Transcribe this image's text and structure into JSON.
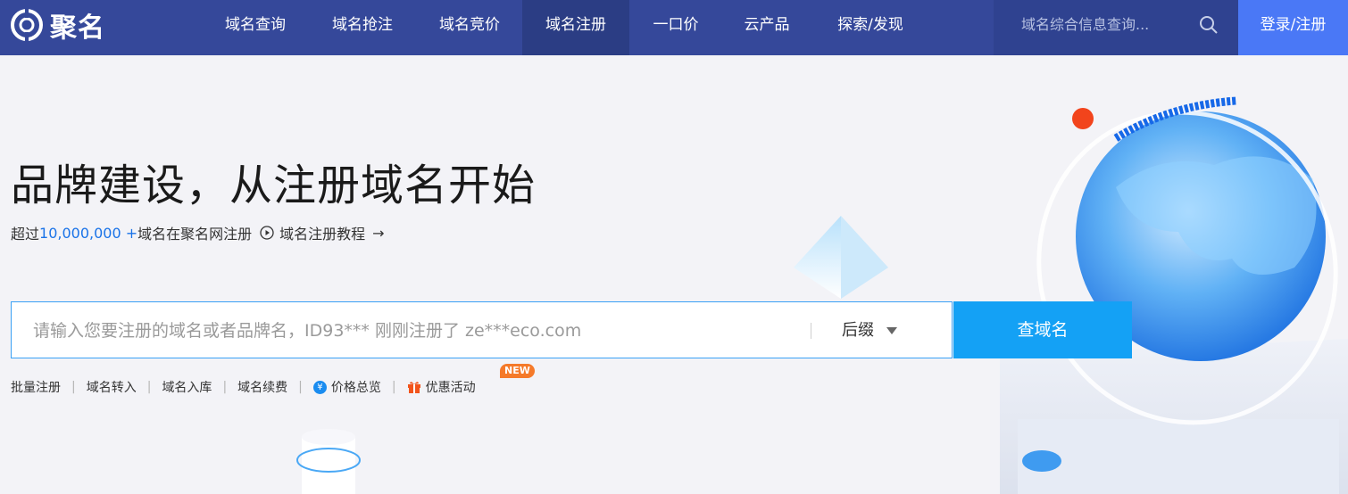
{
  "logo": {
    "text": "聚名"
  },
  "nav": {
    "items": [
      "域名查询",
      "域名抢注",
      "域名竞价",
      "域名注册",
      "一口价",
      "云产品",
      "探索/发现"
    ],
    "active": "域名注册"
  },
  "header_search": {
    "placeholder": "域名综合信息查询..."
  },
  "login": {
    "label": "登录/注册"
  },
  "hero": {
    "title": "品牌建设，从注册域名开始",
    "stats_prefix": "超过",
    "stats_number": "10,000,000 +",
    "stats_suffix": "域名在聚名网注册",
    "tutorial_label": "域名注册教程",
    "tutorial_arrow": "→"
  },
  "domain_search": {
    "placeholder": "请输入您要注册的域名或者品牌名，ID93*** 刚刚注册了 ze***eco.com",
    "suffix_label": "后缀",
    "button_label": "查域名"
  },
  "quick_links": {
    "items": [
      "批量注册",
      "域名转入",
      "域名入库",
      "域名续费",
      "价格总览",
      "优惠活动"
    ],
    "separator": "|",
    "price_icon_glyph": "¥",
    "badge": "NEW"
  },
  "colors": {
    "nav_bg": "#35489a",
    "nav_active_bg": "#2b3d84",
    "login_bg": "#4a78f6",
    "search_button_bg": "#14a1f5",
    "accent_number": "#1a73e8",
    "badge_bg": "#f57a2a"
  },
  "icons": {
    "logo": "juming-logo-icon",
    "header_search": "search-icon",
    "tutorial": "play-circle-icon",
    "suffix_dropdown": "caret-down-icon",
    "price": "yen-circle-icon",
    "promo": "gift-icon"
  }
}
